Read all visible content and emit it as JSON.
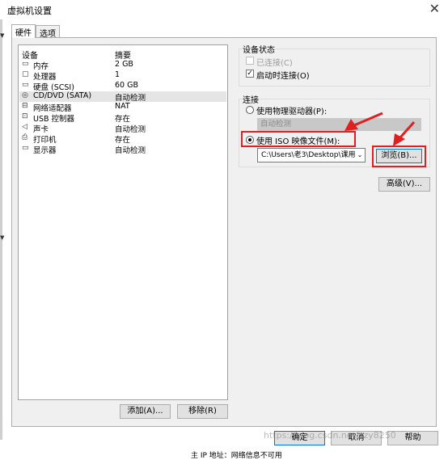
{
  "window": {
    "title": "虚拟机设置",
    "close_glyph": "✕"
  },
  "tabs": [
    {
      "label": "硬件",
      "active": true
    },
    {
      "label": "选项",
      "active": false
    }
  ],
  "device_list": {
    "headers": {
      "device": "设备",
      "summary": "摘要"
    },
    "rows": [
      {
        "icon": "memory-icon",
        "glyph": "▭",
        "name": "内存",
        "summary": "2 GB",
        "selected": false
      },
      {
        "icon": "cpu-icon",
        "glyph": "▢",
        "name": "处理器",
        "summary": "1",
        "selected": false
      },
      {
        "icon": "hdd-icon",
        "glyph": "▭",
        "name": "硬盘 (SCSI)",
        "summary": "60 GB",
        "selected": false
      },
      {
        "icon": "cd-icon",
        "glyph": "◎",
        "name": "CD/DVD (SATA)",
        "summary": "自动检测",
        "selected": true
      },
      {
        "icon": "network-icon",
        "glyph": "⊟",
        "name": "网络适配器",
        "summary": "NAT",
        "selected": false
      },
      {
        "icon": "usb-icon",
        "glyph": "⊡",
        "name": "USB 控制器",
        "summary": "存在",
        "selected": false
      },
      {
        "icon": "sound-icon",
        "glyph": "◁",
        "name": "声卡",
        "summary": "自动检测",
        "selected": false
      },
      {
        "icon": "printer-icon",
        "glyph": "⎙",
        "name": "打印机",
        "summary": "存在",
        "selected": false
      },
      {
        "icon": "display-icon",
        "glyph": "▭",
        "name": "显示器",
        "summary": "自动检测",
        "selected": false
      }
    ],
    "add_button": "添加(A)...",
    "remove_button": "移除(R)"
  },
  "device_status": {
    "title": "设备状态",
    "connected_label": "已连接(C)",
    "connected_checked": false,
    "connect_on_power_label": "启动时连接(O)",
    "connect_on_power_checked": true,
    "check_glyph": "✓"
  },
  "connection": {
    "title": "连接",
    "physical_label": "使用物理驱动器(P):",
    "physical_value": "自动检测",
    "iso_label": "使用 ISO 映像文件(M):",
    "iso_selected": true,
    "iso_path": "C:\\Users\\老3\\Desktop\\课用\\",
    "combo_arrow": "⌄",
    "browse_button": "浏览(B)...",
    "advanced_button": "高级(V)..."
  },
  "footer": {
    "ok": "确定",
    "cancel": "取消",
    "help": "帮助",
    "watermark": "https://blog.csdn.net/zzy8250",
    "below_text": "主 IP 地址：网络信息不可用"
  },
  "colors": {
    "highlight_red": "#e02020",
    "accent_blue": "#0078d7"
  }
}
